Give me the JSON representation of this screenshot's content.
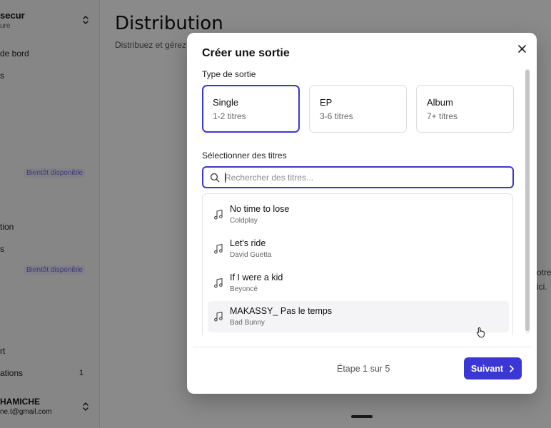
{
  "sidebar": {
    "org_name": "secur",
    "org_sub": "ure",
    "items": [
      {
        "label": "de bord"
      },
      {
        "label": "s"
      },
      {
        "label": "tion"
      },
      {
        "label": "s"
      },
      {
        "label": "rt"
      },
      {
        "label": "ations",
        "count": "1"
      }
    ],
    "soon_badge": "Bientôt disponible",
    "user_name": "HAMICHE",
    "user_email": "ne.t@gmail.com"
  },
  "page": {
    "title": "Distribution",
    "subtitle": "Distribuez et gérez",
    "frag1": "otre",
    "frag2": "ici."
  },
  "modal": {
    "title": "Créer une sortie",
    "type_label": "Type de sortie",
    "types": [
      {
        "name": "Single",
        "range": "1-2 titres",
        "selected": true
      },
      {
        "name": "EP",
        "range": "3-6 titres",
        "selected": false
      },
      {
        "name": "Album",
        "range": "7+ titres",
        "selected": false
      }
    ],
    "tracks_label": "Sélectionner des titres",
    "search_placeholder": "Rechercher des titres...",
    "tracks": [
      {
        "title": "No time to lose",
        "artist": "Coldplay"
      },
      {
        "title": "Let's ride",
        "artist": "David Guetta"
      },
      {
        "title": "If I were a kid",
        "artist": "Beyoncé"
      },
      {
        "title": "MAKASSY_ Pas le temps",
        "artist": "Bad Bunny"
      }
    ],
    "step": "Étape 1 sur 5",
    "next_label": "Suivant"
  },
  "colors": {
    "accent": "#3b36d6",
    "soon_text": "#6d69d6",
    "overlay": "rgba(0,0,0,0.46)"
  },
  "icons": [
    "chevron-up-down-icon",
    "close-icon",
    "search-icon",
    "music-note-icon",
    "chevron-right-icon",
    "hand-pointer-icon"
  ]
}
